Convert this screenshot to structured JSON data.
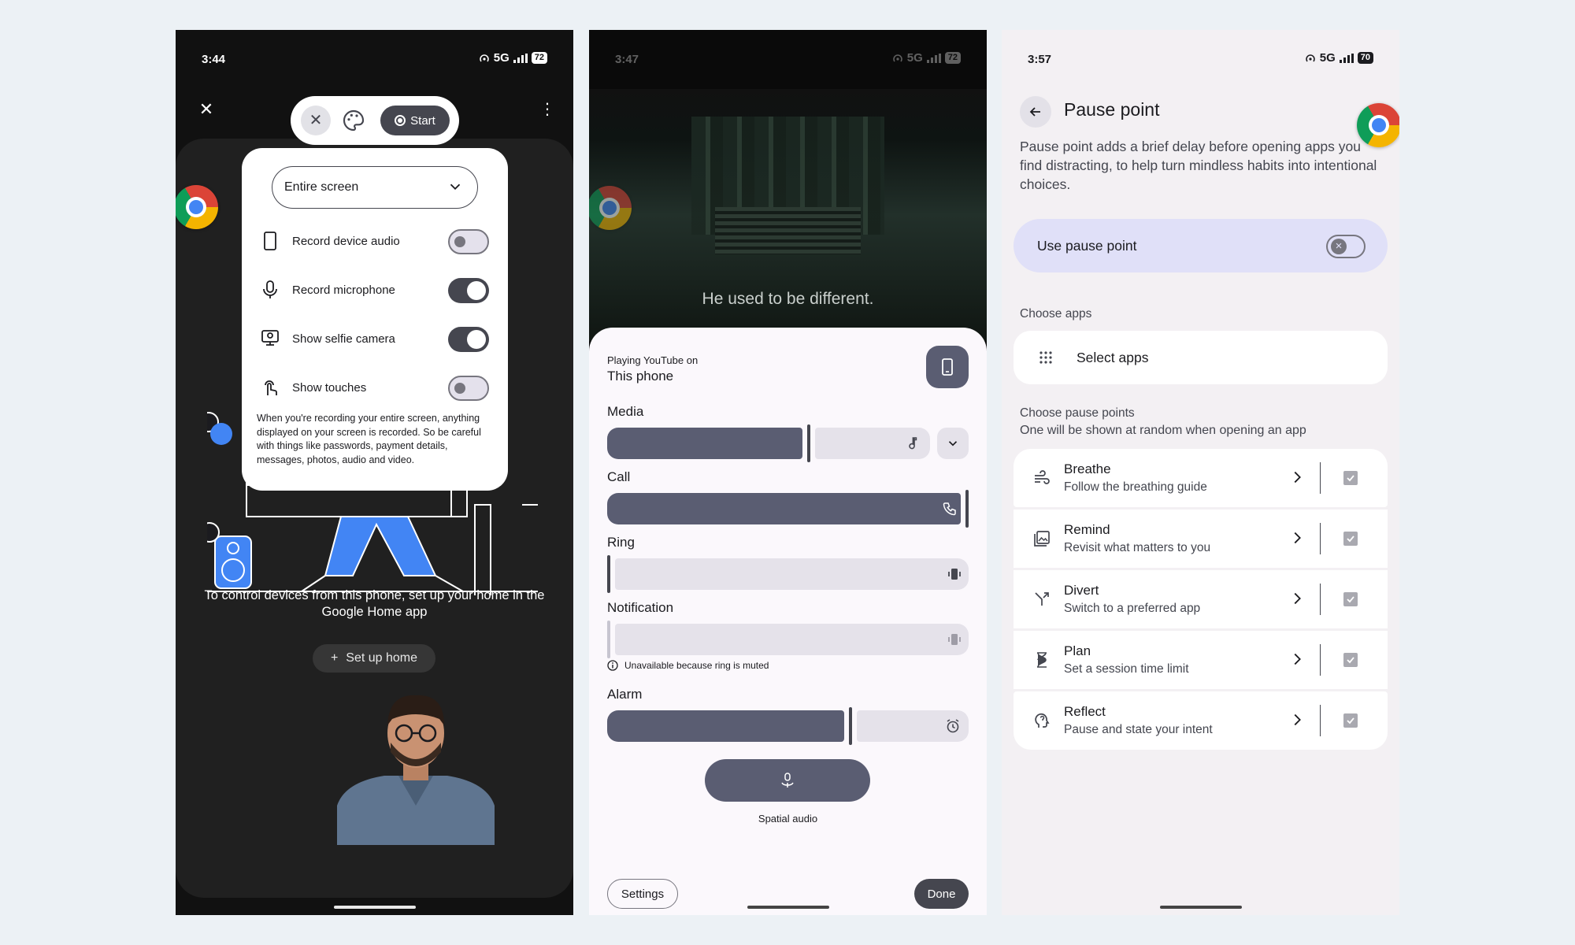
{
  "screen_record": {
    "status": {
      "time": "3:44",
      "network": "5G",
      "battery": "72"
    },
    "toolbar": {
      "start_label": "Start"
    },
    "dropdown": {
      "selected": "Entire screen"
    },
    "options": [
      {
        "label": "Record device audio",
        "on": false
      },
      {
        "label": "Record microphone",
        "on": true
      },
      {
        "label": "Show selfie camera",
        "on": true
      },
      {
        "label": "Show touches",
        "on": false
      }
    ],
    "note": "When you're recording your entire screen, anything displayed on your screen is recorded. So be careful with things like passwords, payment details, messages, photos, audio and video.",
    "home_text": "To control devices from this phone, set up your home in the Google Home app",
    "setup_button": "Set up home"
  },
  "volume_panel": {
    "status": {
      "time": "3:47",
      "network": "5G",
      "battery": "72"
    },
    "video_caption": "He used to be different.",
    "playing_label": "Playing YouTube on",
    "device": "This phone",
    "streams": {
      "media": {
        "label": "Media",
        "level": 0.62
      },
      "call": {
        "label": "Call",
        "level": 1.0
      },
      "ring": {
        "label": "Ring",
        "level": 0.0
      },
      "notification": {
        "label": "Notification",
        "level": 0.0
      },
      "alarm": {
        "label": "Alarm",
        "level": 0.67
      }
    },
    "unavailable_note": "Unavailable because ring is muted",
    "spatial_label": "Spatial audio",
    "settings_button": "Settings",
    "done_button": "Done"
  },
  "pause_point": {
    "status": {
      "time": "3:57",
      "network": "5G",
      "battery": "70"
    },
    "title": "Pause point",
    "description": "Pause point adds a brief delay before opening apps you find distracting, to help turn mindless habits into intentional choices.",
    "use_label": "Use pause point",
    "choose_apps_label": "Choose apps",
    "select_apps": "Select apps",
    "choose_points_label": "Choose pause points",
    "choose_points_sub": "One will be shown at random when opening an app",
    "items": [
      {
        "title": "Breathe",
        "subtitle": "Follow the breathing guide"
      },
      {
        "title": "Remind",
        "subtitle": "Revisit what matters to you"
      },
      {
        "title": "Divert",
        "subtitle": "Switch to a preferred app"
      },
      {
        "title": "Plan",
        "subtitle": "Set a session time limit"
      },
      {
        "title": "Reflect",
        "subtitle": "Pause and state your intent"
      }
    ]
  },
  "colors": {
    "accent": "#45464f",
    "slider_fill": "#5a5d72",
    "pause_card": "#e0e0f8",
    "dark_bg": "#111111"
  }
}
